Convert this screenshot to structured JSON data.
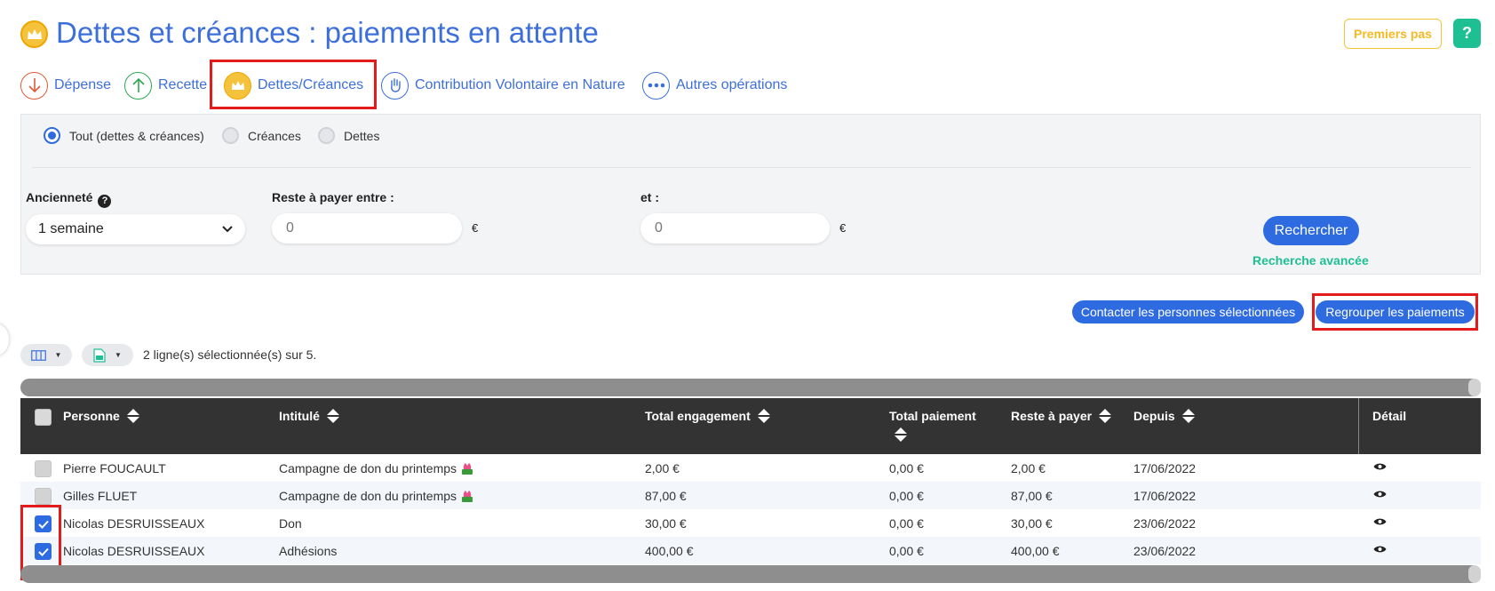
{
  "header": {
    "title": "Dettes et créances : paiements en attente",
    "premiers_pas": "Premiers pas",
    "help": "?"
  },
  "tabs": [
    {
      "label": "Dépense",
      "icon": "arrow-down-icon",
      "color": "#e05a3a"
    },
    {
      "label": "Recette",
      "icon": "arrow-up-icon",
      "color": "#2ea84f"
    },
    {
      "label": "Dettes/Créances",
      "icon": "crown-icon",
      "color": "#f5c33b",
      "active": true
    },
    {
      "label": "Contribution Volontaire en Nature",
      "icon": "hand-icon",
      "color": "#3d6fdb"
    },
    {
      "label": "Autres opérations",
      "icon": "more-icon",
      "color": "#3d6fdb"
    }
  ],
  "filters": {
    "radios": [
      {
        "label": "Tout (dettes & créances)",
        "checked": true
      },
      {
        "label": "Créances",
        "checked": false
      },
      {
        "label": "Dettes",
        "checked": false
      }
    ],
    "anciennete_label": "Ancienneté",
    "anciennete_value": "1 semaine",
    "reste_label": "Reste à payer entre :",
    "reste_min_placeholder": "0",
    "et_label": "et :",
    "reste_max_placeholder": "0",
    "currency": "€",
    "search_button": "Rechercher",
    "advanced_link": "Recherche avancée"
  },
  "actions": {
    "contact_button": "Contacter les personnes sélectionnées",
    "regroup_button": "Regrouper les paiements",
    "selection_text": "2 ligne(s) sélectionnée(s) sur 5."
  },
  "table": {
    "columns": [
      "Personne",
      "Intitulé",
      "Total engagement",
      "Total paiement",
      "Reste à payer",
      "Depuis",
      "Détail"
    ],
    "rows": [
      {
        "checked": false,
        "personne": "Pierre FOUCAULT",
        "intitule": "Campagne de don du printemps",
        "flower": true,
        "engagement": "2,00 €",
        "paiement": "0,00 €",
        "reste": "2,00 €",
        "depuis": "17/06/2022"
      },
      {
        "checked": false,
        "personne": "Gilles FLUET",
        "intitule": "Campagne de don du printemps",
        "flower": true,
        "engagement": "87,00 €",
        "paiement": "0,00 €",
        "reste": "87,00 €",
        "depuis": "17/06/2022"
      },
      {
        "checked": true,
        "personne": "Nicolas DESRUISSEAUX",
        "intitule": "Don",
        "flower": false,
        "engagement": "30,00 €",
        "paiement": "0,00 €",
        "reste": "30,00 €",
        "depuis": "23/06/2022"
      },
      {
        "checked": true,
        "personne": "Nicolas DESRUISSEAUX",
        "intitule": "Adhésions",
        "flower": false,
        "engagement": "400,00 €",
        "paiement": "0,00 €",
        "reste": "400,00 €",
        "depuis": "23/06/2022"
      }
    ]
  },
  "colors": {
    "primary": "#2f6be0",
    "accent_green": "#1fbf94",
    "highlight_red": "#e41b1b",
    "gold": "#f5c33b"
  }
}
